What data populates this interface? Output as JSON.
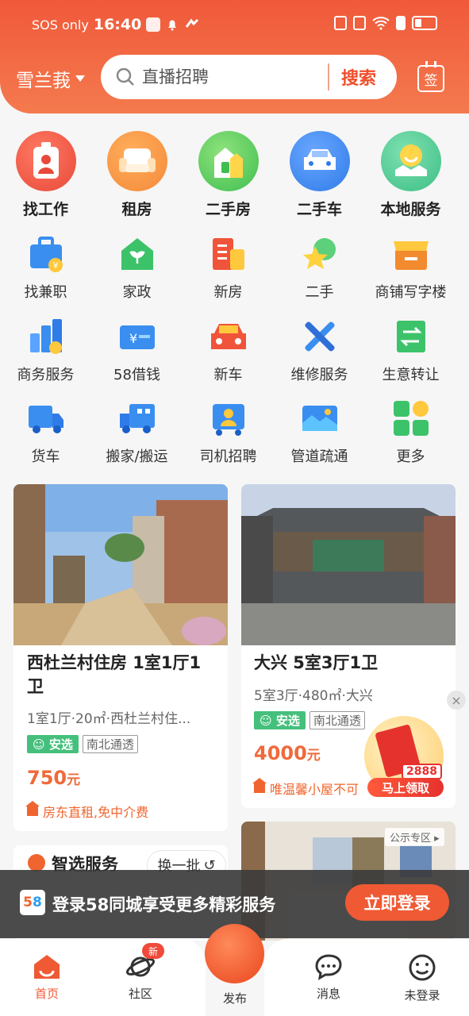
{
  "status_bar": {
    "carrier": "SOS only",
    "time": "16:40"
  },
  "header": {
    "city": "雪兰莪",
    "search_placeholder": "直播招聘",
    "search_button": "搜索",
    "checkin_label": "签"
  },
  "main_categories": [
    {
      "label": "找工作",
      "icon": "badge-icon",
      "color": "#e8493a"
    },
    {
      "label": "租房",
      "icon": "sofa-icon",
      "color": "#f38a3a"
    },
    {
      "label": "二手房",
      "icon": "house-icon",
      "color": "#5ccc5a"
    },
    {
      "label": "二手车",
      "icon": "car-icon",
      "color": "#3a86f0"
    },
    {
      "label": "本地服务",
      "icon": "map-pin-icon",
      "color": "#48c58e"
    }
  ],
  "sub_categories_row1": [
    {
      "label": "找兼职",
      "icon": "briefcase-icon"
    },
    {
      "label": "家政",
      "icon": "plant-house-icon"
    },
    {
      "label": "新房",
      "icon": "building-icon"
    },
    {
      "label": "二手",
      "icon": "star-icon"
    },
    {
      "label": "商铺写字楼",
      "icon": "shop-icon"
    }
  ],
  "sub_categories_row2": [
    {
      "label": "商务服务",
      "icon": "bar-chart-icon"
    },
    {
      "label": "58借钱",
      "icon": "money-card-icon"
    },
    {
      "label": "新车",
      "icon": "new-car-icon"
    },
    {
      "label": "维修服务",
      "icon": "tools-icon"
    },
    {
      "label": "生意转让",
      "icon": "transfer-icon"
    }
  ],
  "sub_categories_row3": [
    {
      "label": "货车",
      "icon": "truck-icon"
    },
    {
      "label": "搬家/搬运",
      "icon": "moving-truck-icon"
    },
    {
      "label": "司机招聘",
      "icon": "driver-icon"
    },
    {
      "label": "管道疏通",
      "icon": "pipe-icon"
    },
    {
      "label": "更多",
      "icon": "more-grid-icon"
    }
  ],
  "listings": [
    {
      "title": "西杜兰村住房 1室1厅1卫",
      "subtitle": "1室1厅·20㎡·西杜兰村住...",
      "tag1": "安选",
      "tag2": "南北通透",
      "price": "750",
      "unit": "元",
      "note": "房东直租,免中介费"
    },
    {
      "title": "大兴 5室3厅1卫",
      "subtitle": "5室3厅·480㎡·大兴",
      "tag1": "安选",
      "tag2": "南北通透",
      "price": "4000",
      "unit": "元",
      "note": "唯温馨小屋不可"
    }
  ],
  "promo": {
    "amount": "2888",
    "button": "马上领取",
    "close": "×"
  },
  "smart_service": {
    "title": "智选服务",
    "refresh": "换一批"
  },
  "ad_label": "公示专区",
  "login_banner": {
    "logo_a": "5",
    "logo_b": "8",
    "text": "登录58同城享受更多精彩服务",
    "button": "立即登录"
  },
  "tabbar": {
    "home": "首页",
    "community": "社区",
    "community_badge": "新",
    "publish": "发布",
    "messages": "消息",
    "profile": "未登录"
  }
}
